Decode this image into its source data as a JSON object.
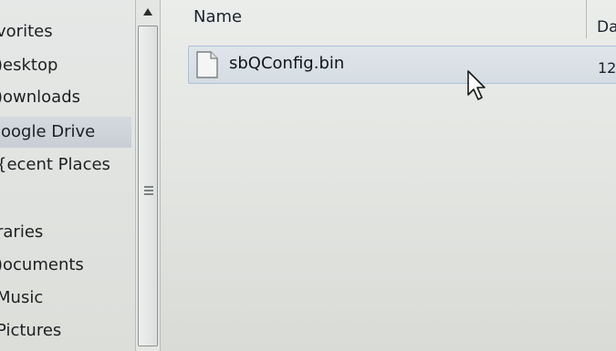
{
  "navigation": {
    "items": [
      {
        "label": "vorites"
      },
      {
        "label": ")esktop"
      },
      {
        "label": ")ownloads"
      },
      {
        "label": "ioogle Drive",
        "selected": true
      },
      {
        "label": "{ecent Places"
      },
      {
        "label": "raries"
      },
      {
        "label": ")ocuments"
      },
      {
        "label": "Music"
      },
      {
        "label": "Pictures"
      }
    ]
  },
  "file_list": {
    "columns": {
      "name": "Name",
      "date": "Da"
    },
    "rows": [
      {
        "name": "sbQConfig.bin",
        "date": "12"
      }
    ]
  },
  "icons": {
    "scroll_up": "triangle-up-icon",
    "scroll_grip": "grip-icon",
    "file": "document-icon",
    "cursor": "arrow-pointer-icon"
  },
  "colors": {
    "selection_border": "#a8c3dc",
    "selected_nav": "#c9ced6"
  }
}
